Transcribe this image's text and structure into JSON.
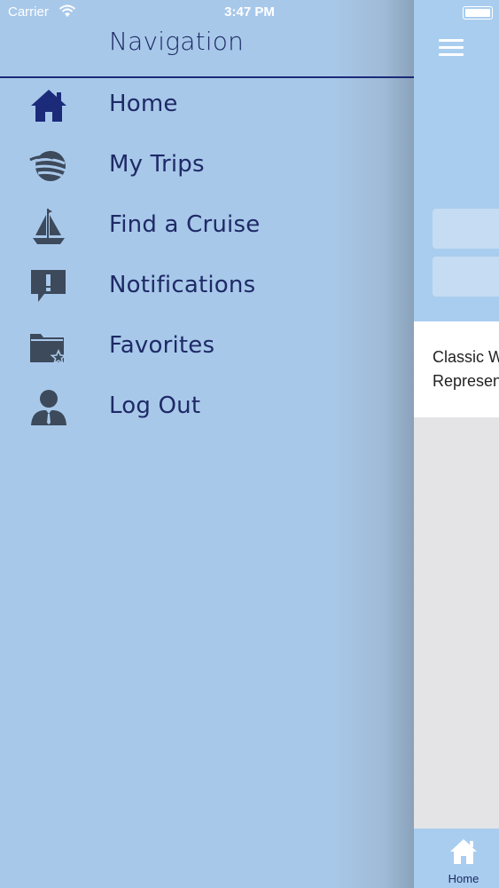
{
  "status_bar": {
    "carrier": "Carrier",
    "time": "3:47 PM"
  },
  "drawer": {
    "title": "Navigation",
    "items": [
      {
        "label": "Home",
        "icon": "home-icon"
      },
      {
        "label": "My Trips",
        "icon": "globe-icon"
      },
      {
        "label": "Find a Cruise",
        "icon": "sailboat-icon"
      },
      {
        "label": "Notifications",
        "icon": "alert-bubble-icon"
      },
      {
        "label": "Favorites",
        "icon": "star-folder-icon"
      },
      {
        "label": "Log Out",
        "icon": "user-icon"
      }
    ]
  },
  "main": {
    "card_lines": [
      "Classic W",
      "Represen"
    ],
    "tabbar": {
      "home_label": "Home"
    }
  },
  "colors": {
    "drawer_bg": "#aac9ea",
    "accent_navy": "#1e2a66",
    "icon_gray": "#3c4a5c"
  }
}
